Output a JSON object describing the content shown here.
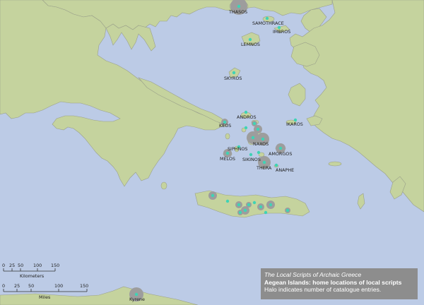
{
  "map": {
    "colors": {
      "sea": "#bccbe6",
      "land": "#c5d39e",
      "coast": "#9aa08a",
      "halo": "#9d9d9d",
      "site": "#3fd3b5"
    },
    "labels": {
      "thasos": "THASOS",
      "samothrace": "SAMOTHRACE",
      "imbros": "IMBROS",
      "lemnos": "LEMNOS",
      "skyros": "SKYROS",
      "andros": "ANDROS",
      "keos": "KEOS",
      "ikaros": "IKAROS",
      "naxos": "NAXOS",
      "siphnos": "SIPHNOS",
      "amorgos": "AMORGOS",
      "melos": "MELOS",
      "sikinos": "SIKINOS",
      "thera": "THERA",
      "anaphe": "ANAPHE",
      "kyrene": "Kyrene"
    }
  },
  "scalebar": {
    "km_ticks": [
      "0",
      "25",
      "50",
      "100",
      "150"
    ],
    "km_unit": "Kilometers",
    "mi_ticks": [
      "0",
      "25",
      "50",
      "100",
      "150"
    ],
    "mi_unit": "Miles"
  },
  "legend": {
    "line1": "The Local Scripts of Archaic Greece",
    "line2": "Aegean Islands: home locations of local scripts",
    "line3": "Halo indicates number of catalogue entries."
  }
}
